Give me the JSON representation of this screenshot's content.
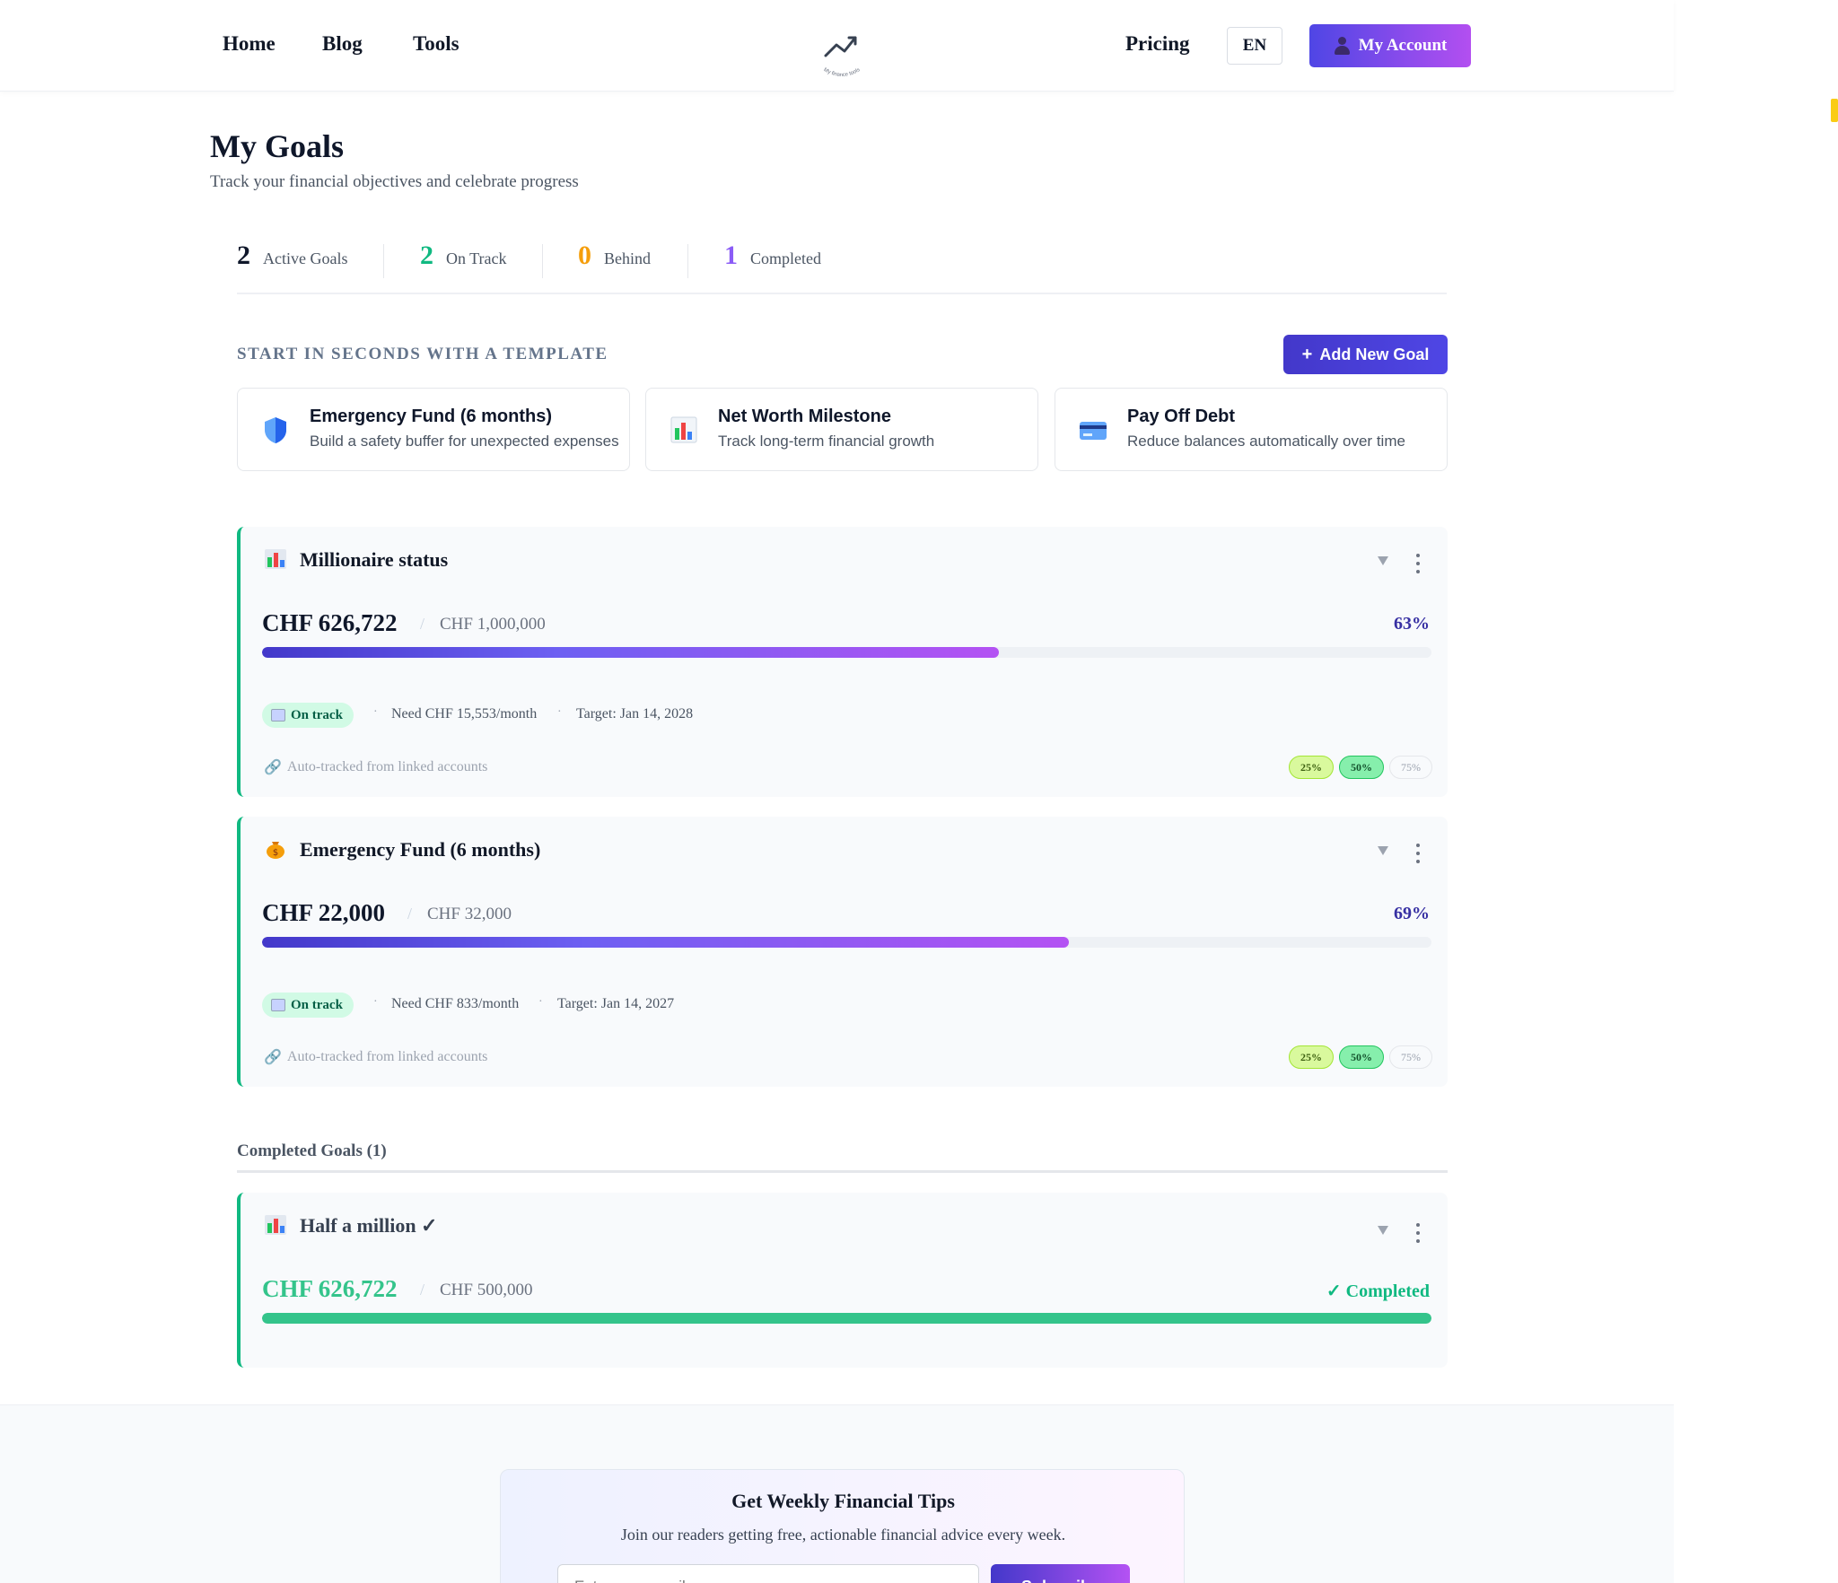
{
  "nav": {
    "links": [
      "Home",
      "Blog",
      "Tools"
    ],
    "pricing": "Pricing",
    "language": "EN",
    "account": "My Account",
    "logo_text": "My finance tools"
  },
  "header": {
    "title": "My Goals",
    "subtitle": "Track your financial objectives and celebrate progress"
  },
  "stats": [
    {
      "value": "2",
      "label": "Active Goals",
      "color": "#0f172a"
    },
    {
      "value": "2",
      "label": "On Track",
      "color": "#10b981"
    },
    {
      "value": "0",
      "label": "Behind",
      "color": "#f59e0b"
    },
    {
      "value": "1",
      "label": "Completed",
      "color": "#8b5cf6"
    }
  ],
  "templates": {
    "title": "START IN SECONDS WITH A TEMPLATE",
    "add_button": "Add New Goal",
    "items": [
      {
        "title": "Emergency Fund (6 months)",
        "desc": "Build a safety buffer for unexpected expenses",
        "icon": "shield-icon"
      },
      {
        "title": "Net Worth Milestone",
        "desc": "Track long-term financial growth",
        "icon": "chart-icon"
      },
      {
        "title": "Pay Off Debt",
        "desc": "Reduce balances automatically over time",
        "icon": "credit-card-icon"
      }
    ]
  },
  "goals": [
    {
      "title": "Millionaire status",
      "icon": "chart-icon",
      "current": "CHF 626,722",
      "separator": "/",
      "target": "CHF 1,000,000",
      "percent_label": "63%",
      "progress": 0.63,
      "status": "On track",
      "need": "Need CHF 15,553/month",
      "target_date": "Target: Jan 14, 2028",
      "auto": "Auto-tracked from linked accounts",
      "milestones": [
        "25%",
        "50%",
        "75%"
      ]
    },
    {
      "title": "Emergency Fund (6 months)",
      "icon": "money-bag-icon",
      "current": "CHF 22,000",
      "separator": "/",
      "target": "CHF 32,000",
      "percent_label": "69%",
      "progress": 0.69,
      "status": "On track",
      "need": "Need CHF 833/month",
      "target_date": "Target: Jan 14, 2027",
      "auto": "Auto-tracked from linked accounts",
      "milestones": [
        "25%",
        "50%",
        "75%"
      ]
    }
  ],
  "completed": {
    "title": "Completed Goals (1)",
    "goal": {
      "title": "Half a million ✓",
      "icon": "chart-icon",
      "current": "CHF 626,722",
      "separator": "/",
      "target": "CHF 500,000",
      "status_label": "✓ Completed",
      "progress": 1.0
    }
  },
  "newsletter": {
    "title": "Get Weekly Financial Tips",
    "subtitle": "Join our readers getting free, actionable financial advice every week.",
    "placeholder": "Enter your email",
    "button": "Subscribe"
  },
  "colors": {
    "accent": "#4338ca",
    "success": "#10b981",
    "warning": "#f59e0b",
    "purple": "#8b5cf6"
  }
}
